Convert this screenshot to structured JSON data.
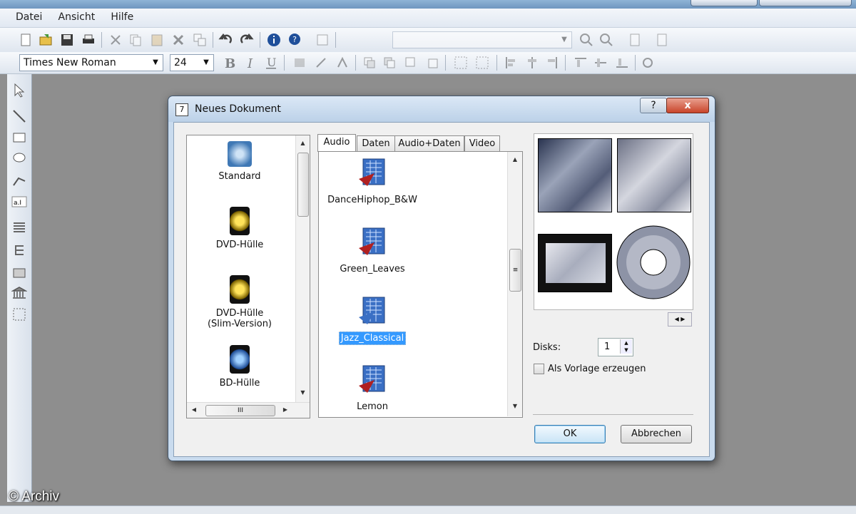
{
  "menu": {
    "items": [
      "Datei",
      "Ansicht",
      "Hilfe"
    ]
  },
  "toolbar2": {
    "font_name": "Times New Roman",
    "font_size": "24"
  },
  "dialog": {
    "title": "Neues Dokument",
    "help_label": "?",
    "close_label": "x",
    "types": [
      {
        "label": "Standard"
      },
      {
        "label": "DVD-Hülle"
      },
      {
        "label": "DVD-Hülle\n(Slim-Version)"
      },
      {
        "label": "BD-Hülle"
      }
    ],
    "tabs": [
      "Audio",
      "Daten",
      "Audio+Daten",
      "Video"
    ],
    "templates": [
      {
        "label": "DanceHiphop_B&W"
      },
      {
        "label": "Green_Leaves"
      },
      {
        "label": "Jazz_Classical"
      },
      {
        "label": "Lemon"
      }
    ],
    "scroll_grip": "III",
    "disks_label": "Disks:",
    "disks_value": "1",
    "vorlage_label": "Als Vorlage erzeugen",
    "ok_label": "OK",
    "cancel_label": "Abbrechen"
  },
  "watermark": "© Archiv",
  "colors": {
    "selection": "#3399ff",
    "close_button": "#c9452b",
    "title_gradient": "#bcd1e8"
  }
}
